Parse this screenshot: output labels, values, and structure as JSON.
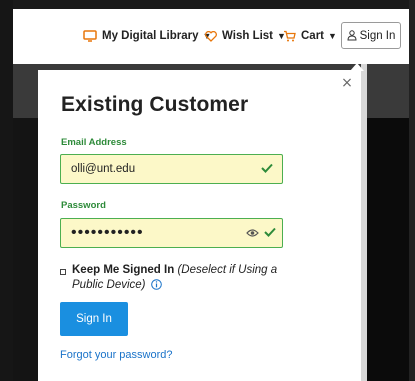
{
  "header": {
    "my_library": "My Digital Library",
    "wish_list": "Wish List",
    "cart": "Cart",
    "sign_in": "Sign In"
  },
  "popup": {
    "title": "Existing Customer",
    "email_label": "Email Address",
    "email_value": "olli@unt.edu",
    "password_label": "Password",
    "password_value": "•••••••••••",
    "remember_bold": "Keep Me Signed In",
    "remember_note": "(Deselect if Using a Public Device)",
    "submit": "Sign In",
    "forgot": "Forgot your password?",
    "close": "×"
  },
  "colors": {
    "accent_orange": "#e8760a",
    "success_green": "#2e8b3a",
    "field_fill": "#fcf8c8",
    "button_blue": "#1a8fe0",
    "link_blue": "#1a73c9"
  },
  "icons": {
    "library": "monitor-icon",
    "wish_list": "heart-icon",
    "cart": "cart-icon",
    "sign_in": "user-icon",
    "email_valid": "check-icon",
    "password_show": "eye-icon",
    "password_valid": "check-icon",
    "info": "info-icon",
    "remember": "checkbox-icon",
    "close": "close-icon"
  }
}
